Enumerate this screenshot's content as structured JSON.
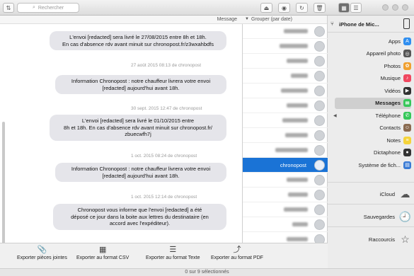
{
  "toolbar": {
    "search_placeholder": "Rechercher",
    "search_icon": "search-icon",
    "sort_icon": "sort-icon",
    "buttons": [
      "eject-icon",
      "eye-icon",
      "refresh-icon",
      "trash-icon",
      "grid-icon",
      "list-icon"
    ]
  },
  "messages": {
    "header": "Message",
    "items": [
      {
        "lines": [
          "L'envoi [redacted] sera livré le 27/08/2015 entre 8h et 18h.",
          "En cas d'absence rdv avant minuit sur chronopost.fr/z3wxahbdfs"
        ]
      },
      {
        "ts": "27 août 2015 08:13 de chronopost"
      },
      {
        "lines": [
          "Information Chronopost : notre chauffeur livrera votre envoi",
          "[redacted] aujourd'hui avant 18h."
        ]
      },
      {
        "ts": "30 sept. 2015 12:47 de chronopost"
      },
      {
        "lines": [
          "L'envoi [redacted] sera livré le 01/10/2015 entre",
          "8h et 18h. En cas d'absence rdv avant minuit sur chronopost.fr/",
          "zbuecwfh7j"
        ]
      },
      {
        "ts": "1 oct. 2015 08:24 de chronopost"
      },
      {
        "lines": [
          "Information Chronopost : notre chauffeur livrera votre envoi",
          "[redacted] aujourd'hui avant 18h."
        ]
      },
      {
        "ts": "1 oct. 2015 12:14 de chronopost"
      },
      {
        "lines": [
          "Chronopost vous informe que l'envoi [redacted] a été",
          "déposé ce jour dans la boite aux lettres du destinataire (en",
          "accord avec l'expéditeur)."
        ]
      }
    ]
  },
  "conversations": {
    "sort_label": "Grouper (par date)",
    "selected_label": "chronopost",
    "selected_index": 9,
    "count": 15
  },
  "actions": [
    {
      "label": "Exporter pièces jointes",
      "icon": "paperclip-icon"
    },
    {
      "label": "Exporter au format CSV",
      "icon": "csv-icon"
    },
    {
      "label": "Exporter au format Texte",
      "icon": "text-doc-icon"
    },
    {
      "label": "Exporter au format PDF",
      "icon": "pdf-icon"
    }
  ],
  "status": {
    "text": "0 sur 9 sélectionnés"
  },
  "sidebar": {
    "device": "iPhone de Mic...",
    "device_icon": "iphone-icon",
    "items": [
      {
        "label": "Apps",
        "icon": "apps-icon",
        "color": "#2f8ef0"
      },
      {
        "label": "Appareil photo",
        "icon": "camera-icon",
        "color": "#555555"
      },
      {
        "label": "Photos",
        "icon": "photos-icon",
        "color": "#f0a030"
      },
      {
        "label": "Musique",
        "icon": "music-icon",
        "color": "#f04860"
      },
      {
        "label": "Vidéos",
        "icon": "video-icon",
        "color": "#303030"
      },
      {
        "label": "Messages",
        "icon": "messages-icon",
        "color": "#35c759"
      },
      {
        "label": "Téléphone",
        "icon": "phone-icon",
        "color": "#35c759"
      },
      {
        "label": "Contacts",
        "icon": "contacts-icon",
        "color": "#8a6a50"
      },
      {
        "label": "Notes",
        "icon": "notes-icon",
        "color": "#f5d33a"
      },
      {
        "label": "Dictaphone",
        "icon": "microphone-icon",
        "color": "#333333"
      },
      {
        "label": "Système de fich...",
        "icon": "filesystem-icon",
        "color": "#3a7bd5"
      }
    ],
    "icloud": "iCloud",
    "sauvegardes": "Sauvegardes",
    "raccourcis": "Raccourcis"
  }
}
